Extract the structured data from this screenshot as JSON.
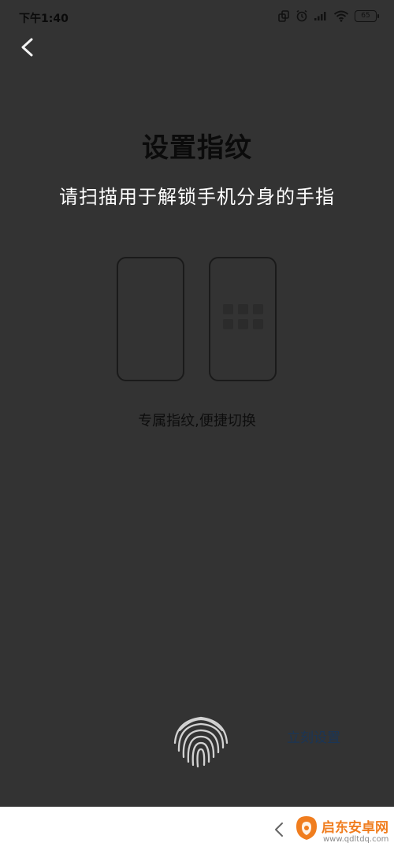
{
  "status_bar": {
    "time": "下午1:40",
    "battery": "65",
    "icons": [
      "dual-app-icon",
      "alarm-icon",
      "signal-icon",
      "wifi-icon",
      "battery-icon"
    ]
  },
  "header": {
    "back_icon": "chevron-left-icon"
  },
  "main": {
    "title": "设置指纹",
    "subtitle": "请扫描用于解锁手机分身的手指",
    "caption": "专属指纹,便捷切换"
  },
  "footer": {
    "fingerprint_icon": "fingerprint-icon",
    "setup_label": "立刻设置"
  },
  "nav_bar": {
    "back_icon": "nav-back-icon"
  },
  "watermark": {
    "name": "启东安卓网",
    "url": "www.qdltdq.com",
    "colors": {
      "brand": "#f07d1e",
      "url": "#8a8a8a"
    }
  },
  "colors": {
    "background": "#333333",
    "accent_link": "#1a3556",
    "title": "#0b0b0b",
    "subtitle": "#ffffff"
  }
}
